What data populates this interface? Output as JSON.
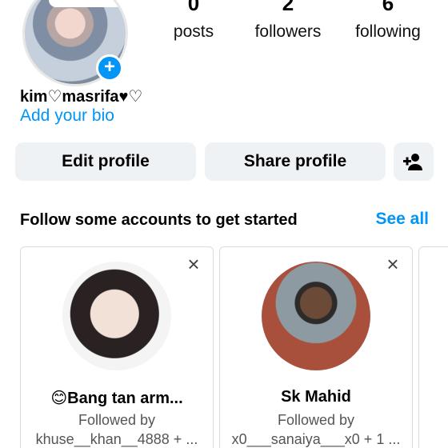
{
  "profile": {
    "username": "kim♡masrifa♥♡",
    "bio_link": "Add your bio",
    "stats": [
      {
        "num": "0",
        "label": "posts"
      },
      {
        "num": "2",
        "label": "followers"
      },
      {
        "num": "6",
        "label": "following"
      }
    ],
    "add_story_icon": "+"
  },
  "actions": {
    "edit_profile": "Edit profile",
    "share_profile": "Share profile",
    "add_user_icon": "person-add-icon"
  },
  "suggestions": {
    "heading": "Follow some accounts to get started",
    "see_all": "See all",
    "cards": [
      {
        "name": "😊Bang tan arm...",
        "followed_by_1": "Followed by",
        "followed_by_2": "khuse__khan__4888 + ..."
      },
      {
        "name": "Sk Mahid",
        "followed_by_1": "Followed by",
        "followed_by_2": "x0___sanaiya___x0 + 1 ..."
      }
    ]
  },
  "colors": {
    "accent": "#0095f6",
    "button_bg": "#eff2f5"
  }
}
